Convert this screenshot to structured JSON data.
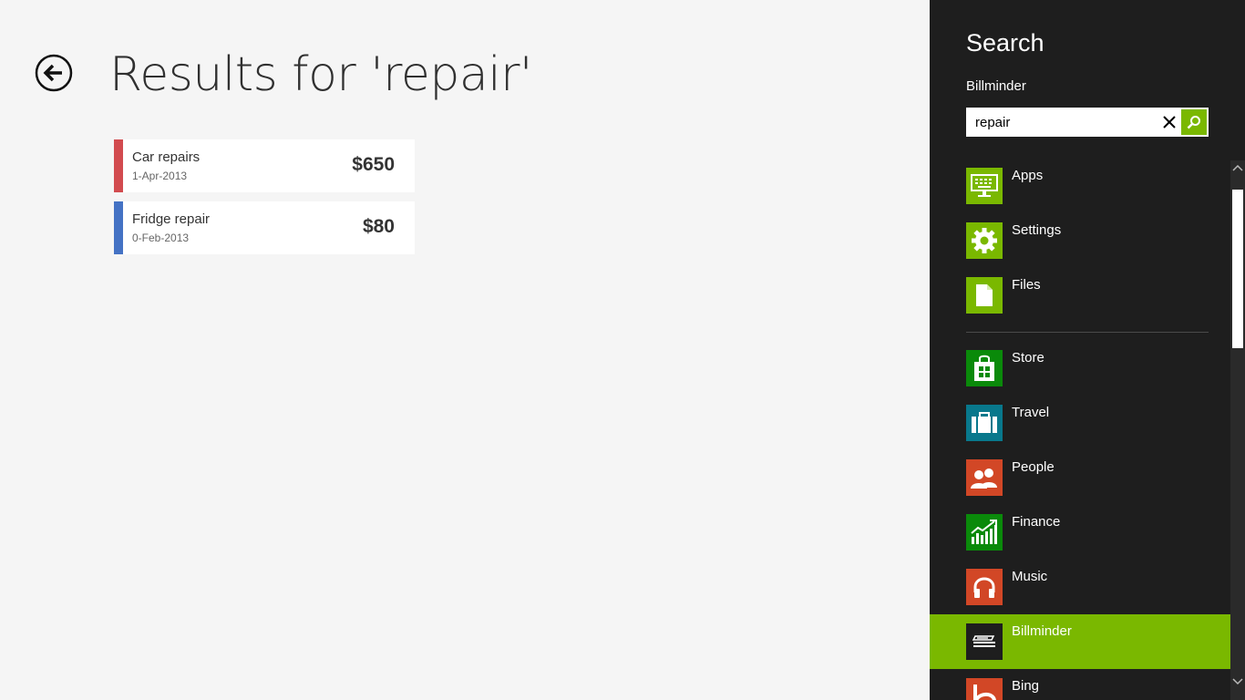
{
  "main": {
    "title": "Results for 'repair'",
    "results": [
      {
        "name": "Car repairs",
        "date": "1-Apr-2013",
        "amount": "$650",
        "color": "#d24b4f"
      },
      {
        "name": "Fridge repair",
        "date": "0-Feb-2013",
        "amount": "$80",
        "color": "#4472c4"
      }
    ]
  },
  "search": {
    "title": "Search",
    "scope": "Billminder",
    "query": "repair",
    "accent": "#7ab800",
    "system_items": [
      {
        "label": "Apps",
        "icon": "apps-icon",
        "color": "#7ab800"
      },
      {
        "label": "Settings",
        "icon": "settings-gear-icon",
        "color": "#7ab800"
      },
      {
        "label": "Files",
        "icon": "file-icon",
        "color": "#7ab800"
      }
    ],
    "app_items": [
      {
        "label": "Store",
        "icon": "store-icon",
        "color": "#0a8a0a"
      },
      {
        "label": "Travel",
        "icon": "travel-suitcase-icon",
        "color": "#08788c"
      },
      {
        "label": "People",
        "icon": "people-icon",
        "color": "#d24726"
      },
      {
        "label": "Finance",
        "icon": "finance-chart-icon",
        "color": "#0a8a0a"
      },
      {
        "label": "Music",
        "icon": "music-headphones-icon",
        "color": "#d24726"
      },
      {
        "label": "Billminder",
        "icon": "billminder-icon",
        "color": "#1e1e1e"
      },
      {
        "label": "Bing",
        "icon": "bing-icon",
        "color": "#d24726"
      }
    ]
  }
}
